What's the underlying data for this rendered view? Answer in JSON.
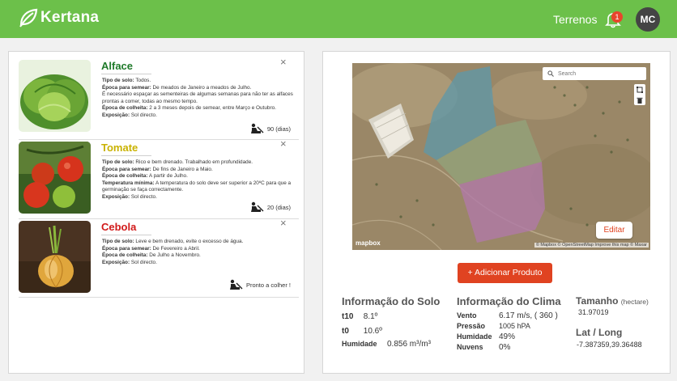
{
  "app": {
    "name": "Kertana"
  },
  "header": {
    "nav_terrenos": "Terrenos",
    "notification_count": "1",
    "user_initials": "MC"
  },
  "colors": {
    "brand_green": "#6cc04a",
    "accent_red": "#e04321"
  },
  "crops": [
    {
      "name": "Alface",
      "name_color": "#1f7a2a",
      "lines": [
        {
          "label": "Tipo de solo:",
          "text": " Todos."
        },
        {
          "label": "Época para semear:",
          "text": " De meados de Janeiro a meados de Julho."
        },
        {
          "label": "",
          "text": "É necessário espaçar as sementeiras de algumas semanas para não ter as alfaces prontas a comer, todas ao mesmo tempo."
        },
        {
          "label": "Época de colheita:",
          "text": " 2 a 3 meses depois de semear, entre Março e Outubro."
        },
        {
          "label": "Exposição:",
          "text": " Sol directo."
        }
      ],
      "harvest": "90 (dias)",
      "close": "×"
    },
    {
      "name": "Tomate",
      "name_color": "#c9b200",
      "lines": [
        {
          "label": "Tipo de solo:",
          "text": " Rico e bem drenado. Trabalhado em profundidade."
        },
        {
          "label": "Época para semear:",
          "text": " De fins de Janeiro a Maio."
        },
        {
          "label": "Época de colheita:",
          "text": " A partir de Julho."
        },
        {
          "label": "Temperatura mínima:",
          "text": " A temperatura do solo deve ser superior a 20ºC para que a germinação se faça correctamente."
        },
        {
          "label": "Exposição:",
          "text": " Sol directo."
        }
      ],
      "harvest": "20 (dias)",
      "close": "×"
    },
    {
      "name": "Cebola",
      "name_color": "#d11a1a",
      "lines": [
        {
          "label": "Tipo de solo:",
          "text": " Leve e bem drenado, evite o excesso de água."
        },
        {
          "label": "Época para semear:",
          "text": " De Fevereiro a Abril."
        },
        {
          "label": "Época de colheita:",
          "text": " De Julho a Novembro."
        },
        {
          "label": "Exposição:",
          "text": " Sol directo."
        }
      ],
      "harvest": "Pronto a colher !",
      "close": "×"
    }
  ],
  "map": {
    "search_placeholder": "Search",
    "edit_label": "Editar",
    "brand": "mapbox",
    "attribution": "© Mapbox © OpenStreetMap Improve this map © Maxar",
    "field_colors": [
      "#5f97a8",
      "#93a27a",
      "#b07aa6"
    ]
  },
  "add_product_label": "+ Adicionar Produto",
  "soil": {
    "title": "Informação do Solo",
    "rows": [
      {
        "key": "t10",
        "value": "8.1º"
      },
      {
        "key": "t0",
        "value": "10.6º"
      },
      {
        "key": "Humidade",
        "value": "0.856 m³/m³"
      }
    ]
  },
  "climate": {
    "title": "Informação do Clima",
    "rows": [
      {
        "key": "Vento",
        "value": "6.17 m/s, ( 360 )"
      },
      {
        "key": "Pressão",
        "value": "1005 hPA"
      },
      {
        "key": "Humidade",
        "value": "49%"
      },
      {
        "key": "Nuvens",
        "value": "0%"
      }
    ]
  },
  "size": {
    "title": "Tamanho",
    "unit": "(hectare)",
    "value": "31.97019"
  },
  "location": {
    "title": "Lat / Long",
    "value": "-7.387359,39.36488"
  }
}
